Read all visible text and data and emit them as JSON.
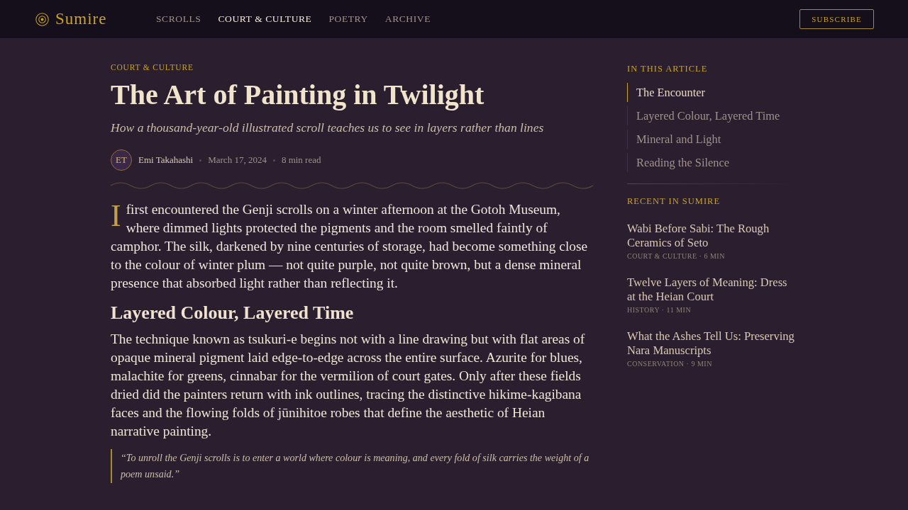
{
  "header": {
    "logo": "Sumire",
    "nav": [
      {
        "label": "SCROLLS",
        "selected": false
      },
      {
        "label": "COURT & CULTURE",
        "selected": true
      },
      {
        "label": "POETRY",
        "selected": false
      },
      {
        "label": "ARCHIVE",
        "selected": false
      }
    ],
    "subscribe_button": "SUBSCRIBE"
  },
  "article": {
    "category": "COURT & CULTURE",
    "title": "The Art of Painting in Twilight",
    "subtitle": "How a thousand-year-old illustrated scroll teaches us to see in layers rather than lines",
    "author": {
      "initials": "ET",
      "name": "Emi Takahashi"
    },
    "date": "March 17, 2024",
    "read_time": "8 min read",
    "body": [
      {
        "kind": "paragraph",
        "drop_cap": true,
        "text": "I first encountered the Genji scrolls on a winter afternoon at the Gotoh Museum, where dimmed lights protected the pigments and the room smelled faintly of camphor. The silk, darkened by nine centuries of storage, had become something close to the colour of winter plum — not quite purple, not quite brown, but a dense mineral presence that absorbed light rather than reflecting it."
      },
      {
        "kind": "heading",
        "text": "Layered Colour, Layered Time"
      },
      {
        "kind": "paragraph",
        "drop_cap": false,
        "text": "The technique known as tsukuri-e begins not with a line drawing but with flat areas of opaque mineral pigment laid edge-to-edge across the entire surface. Azurite for blues, malachite for greens, cinnabar for the vermilion of court gates. Only after these fields dried did the painters return with ink outlines, tracing the distinctive hikime-kagibana faces and the flowing folds of jūnihitoe robes that define the aesthetic of Heian narrative painting."
      },
      {
        "kind": "quote",
        "text": "“To unroll the Genji scrolls is to enter a world where colour is meaning, and every fold of silk carries the weight of a poem unsaid.”"
      }
    ]
  },
  "sidebar": {
    "toc_title": "IN THIS ARTICLE",
    "toc": [
      {
        "label": "The Encounter",
        "selected": true
      },
      {
        "label": "Layered Colour, Layered Time",
        "selected": false
      },
      {
        "label": "Mineral and Light",
        "selected": false
      },
      {
        "label": "Reading the Silence",
        "selected": false
      }
    ],
    "recent_title": "RECENT IN SUMIRE",
    "recent": [
      {
        "title": "Wabi Before Sabi: The Rough Ceramics of Seto",
        "meta": "COURT & CULTURE · 6 MIN"
      },
      {
        "title": "Twelve Layers of Meaning: Dress at the Heian Court",
        "meta": "HISTORY · 11 MIN"
      },
      {
        "title": "What the Ashes Tell Us: Preserving Nara Manuscripts",
        "meta": "CONSERVATION · 9 MIN"
      }
    ]
  }
}
